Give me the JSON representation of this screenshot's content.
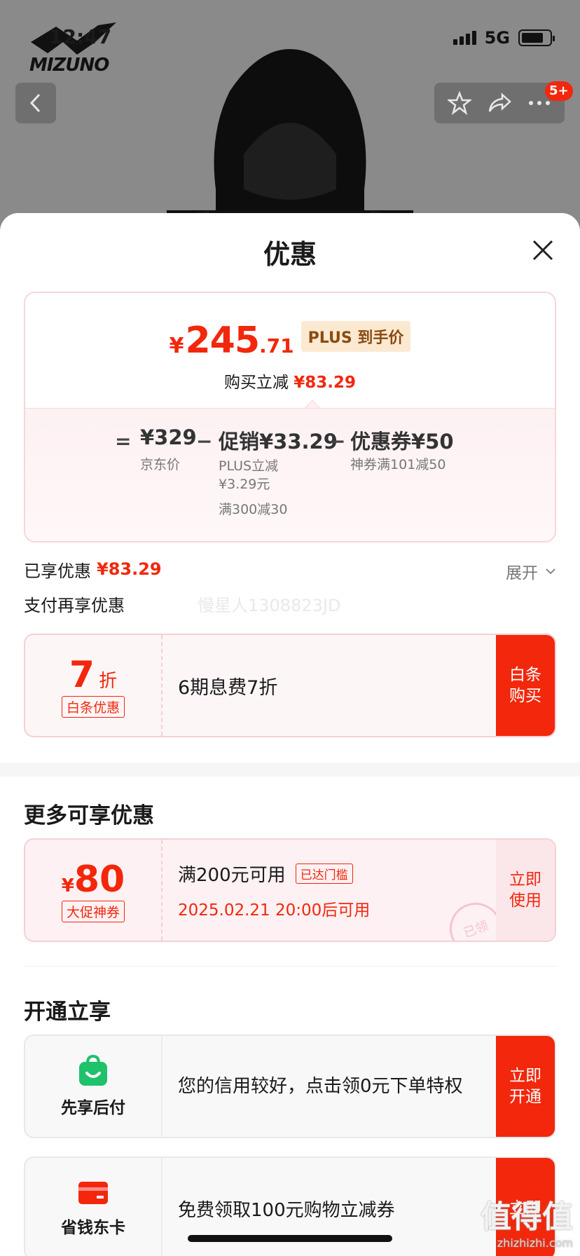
{
  "status_bar": {
    "time": "12:47",
    "network": "5G"
  },
  "product": {
    "brand": "MIZUNO"
  },
  "nav": {
    "badge": "5+"
  },
  "sheet": {
    "title": "优惠"
  },
  "price_card": {
    "currency": "¥",
    "price_int": "245",
    "price_dec": ".71",
    "plus_tag": "PLUS 到手价",
    "instant_label": "购买立减",
    "instant_amount": "¥83.29",
    "equals": "=",
    "minus": "−",
    "base_price": "¥329",
    "base_label": "京东价",
    "promo_value": "促销¥33.29",
    "promo_line1": "PLUS立减",
    "promo_line2": "¥3.29元",
    "promo_line3": "满300减30",
    "coupon_value": "优惠券¥50",
    "coupon_label": "神券满101减50"
  },
  "saved": {
    "label": "已享优惠",
    "amount": "¥83.29",
    "expand": "展开"
  },
  "pay_more": {
    "title": "支付再享优惠",
    "watermark": "慢星人1308823JD"
  },
  "baitiao": {
    "discount": "7",
    "unit": "折",
    "tag": "白条优惠",
    "desc": "6期息费7折",
    "button": "白条购买"
  },
  "more": {
    "title": "更多可享优惠",
    "coupon_currency": "¥",
    "coupon_amount": "80",
    "coupon_tag": "大促神券",
    "condition": "满200元可用",
    "reached": "已达门槛",
    "time": "2025.02.21 20:00后可用",
    "stamp": "已领",
    "button": "立即使用"
  },
  "open": {
    "title": "开通立享",
    "items": [
      {
        "name": "先享后付",
        "desc": "您的信用较好，点击领0元下单特权",
        "button": "立即开通",
        "icon": "shopping-bag-icon"
      },
      {
        "name": "省钱东卡",
        "desc": "免费领取100元购物立减券",
        "button": "立即",
        "icon": "card-icon"
      }
    ]
  },
  "watermark_site": {
    "name": "值得值",
    "url": "zhizhizhi.com"
  },
  "colors": {
    "accent": "#f2270c",
    "plus": "#8a4b10"
  }
}
